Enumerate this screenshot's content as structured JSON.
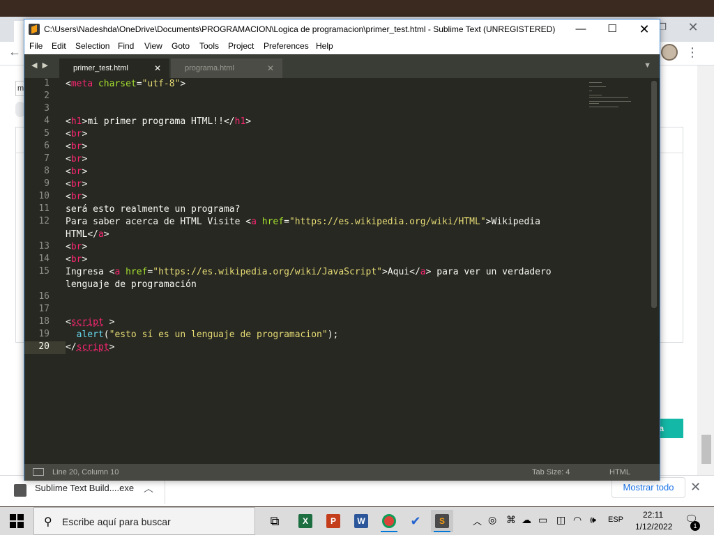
{
  "sublime": {
    "title": "C:\\Users\\Nadeshda\\OneDrive\\Documents\\PROGRAMACION\\Logica de programacion\\primer_test.html - Sublime Text (UNREGISTERED)",
    "menu": [
      "File",
      "Edit",
      "Selection",
      "Find",
      "View",
      "Goto",
      "Tools",
      "Project",
      "Preferences",
      "Help"
    ],
    "tabs": [
      {
        "label": "primer_test.html",
        "active": true
      },
      {
        "label": "programa.html",
        "active": false
      }
    ],
    "line_numbers": [
      "1",
      "2",
      "3",
      "4",
      "5",
      "6",
      "7",
      "8",
      "9",
      "10",
      "11",
      "12",
      "",
      "13",
      "14",
      "15",
      "",
      "16",
      "17",
      "18",
      "19",
      "20"
    ],
    "code": {
      "l1_meta": "meta",
      "l1_attr": "charset",
      "l1_val": "\"utf-8\"",
      "l4_open": "h1",
      "l4_text": "mi primer programa HTML!!",
      "l4_close": "h1",
      "br": "br",
      "l11": "será esto realmente un programa?",
      "l12_pre": "Para saber acerca de HTML Visite ",
      "l12_tag": "a",
      "l12_attr": "href",
      "l12_val": "\"https://es.wikipedia.org/wiki/HTML\"",
      "l12_text": "Wikipedia",
      "l12b_text": "HTML",
      "l12b_tag": "a",
      "l15_pre": "Ingresa ",
      "l15_tag": "a",
      "l15_attr": "href",
      "l15_val": "\"https://es.wikipedia.org/wiki/JavaScript\"",
      "l15_text": "Aqui",
      "l15_close": "a",
      "l15_post": " para ver un verdadero",
      "l15b": "lenguaje de programación",
      "l18_tag": "script",
      "l19_fn": "alert",
      "l19_str": "\"esto sí es un lenguaje de programacion\"",
      "l20_tag": "script"
    },
    "status": {
      "position": "Line 20, Column 10",
      "tab_size": "Tab Size: 4",
      "syntax": "HTML"
    }
  },
  "browser": {
    "field_text": "m",
    "button_partial": "nta",
    "download_name": "Sublime Text Build....exe",
    "show_all": "Mostrar todo"
  },
  "taskbar": {
    "search_placeholder": "Escribe aquí para buscar",
    "lang": "ESP",
    "time": "22:11",
    "date": "1/12/2022",
    "notifications": "1"
  },
  "colors": {
    "tag": "#f92672",
    "attr": "#a6e22e",
    "string": "#e6db74",
    "fn": "#66d9ef",
    "bg": "#272822"
  }
}
